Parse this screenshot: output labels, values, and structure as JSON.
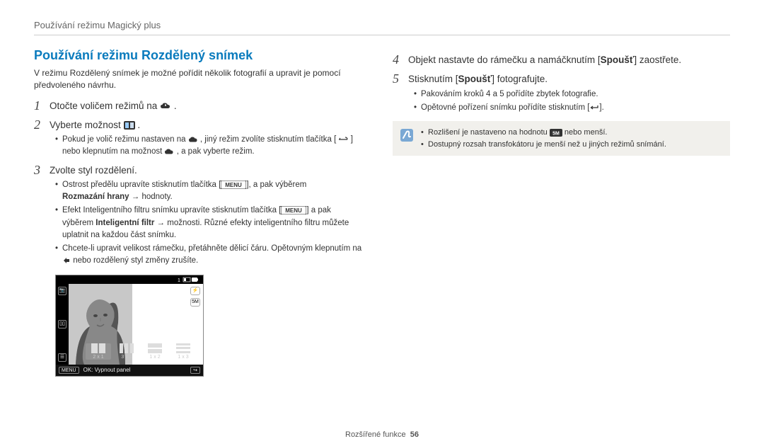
{
  "header": "Používání režimu Magický plus",
  "section_title": "Používání režimu Rozdělený snímek",
  "intro": "V režimu Rozdělený snímek je možné pořídit několik fotografií a upravit je pomocí předvoleného návrhu.",
  "steps": {
    "s1": {
      "num": "1",
      "text_a": "Otočte voličem režimů na ",
      "text_b": "."
    },
    "s2": {
      "num": "2",
      "text_a": "Vyberte možnost ",
      "text_b": "."
    },
    "s2_bullet": {
      "a": "Pokud je volič režimu nastaven na ",
      "b": ", jiný režim zvolíte stisknutím tlačítka [",
      "c": "] nebo klepnutím na možnost ",
      "d": ", a pak vyberte režim."
    },
    "s3": {
      "num": "3",
      "text": "Zvolte styl rozdělení."
    },
    "s3_bullets": {
      "b1a": "Ostrost předělu upravíte stisknutím tlačítka [",
      "b1b": "], a pak výběrem",
      "b1c": "Rozmazání hrany",
      "b1d": " → hodnoty.",
      "b2a": "Efekt Inteligentního filtru snímku upravíte stisknutím tlačítka [",
      "b2b": "] a pak",
      "b2c": "výběrem ",
      "b2d": "Inteligentní filtr",
      "b2e": " → možnosti. Různé efekty inteligentního filtru můžete uplatnit na každou část snímku.",
      "b3a": "Chcete-li upravit velikost rámečku, přetáhněte dělicí čáru. Opětovným klepnutím na ",
      "b3b": " nebo rozdělený styl změny zrušíte."
    },
    "s4": {
      "num": "4",
      "text_a": "Objekt nastavte do rámečku a namáčknutím [",
      "text_b": "Spoušť",
      "text_c": "] zaostřete."
    },
    "s5": {
      "num": "5",
      "text_a": "Stisknutím [",
      "text_b": "Spoušť",
      "text_c": "] fotografujte."
    },
    "s5_bullets": {
      "b1": "Pakováním kroků 4 a 5 pořídíte zbytek fotografie.",
      "b2a": "Opětovné pořízení snímku pořídíte stisknutím [",
      "b2b": "]."
    }
  },
  "note": {
    "n1a": "Rozlišení je nastaveno na hodnotu ",
    "n1b": " nebo menší.",
    "n2": "Dostupný rozsah transfokátoru je menší než u jiných režimů snímání."
  },
  "camera": {
    "layout1": "2 x 1",
    "layout2": "3 x 1",
    "layout3": "1 x 2",
    "layout4": "1 x 3",
    "menu": "MENU",
    "ok_label": "OK: Vypnout panel",
    "flash_icon": "⚡",
    "res_icon": "5M"
  },
  "footer": {
    "label": "Rozšířené funkce",
    "page": "56"
  },
  "labels": {
    "menu_text": "MENU"
  }
}
